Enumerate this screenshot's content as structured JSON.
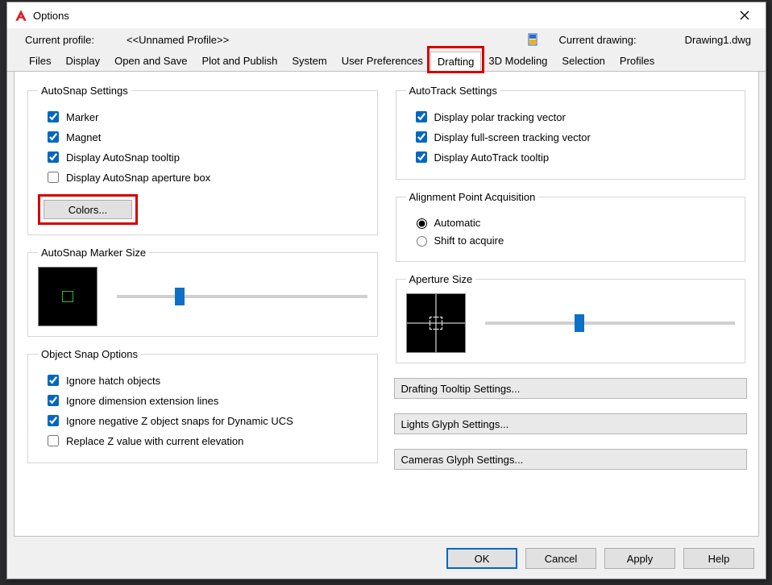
{
  "title": "Options",
  "profile": {
    "label": "Current profile:",
    "value": "<<Unnamed Profile>>",
    "drawing_label": "Current drawing:",
    "drawing_value": "Drawing1.dwg"
  },
  "tabs": {
    "files": "Files",
    "display": "Display",
    "open_save": "Open and Save",
    "plot_publish": "Plot and Publish",
    "system": "System",
    "user_prefs": "User Preferences",
    "drafting": "Drafting",
    "modeling": "3D Modeling",
    "selection": "Selection",
    "profiles": "Profiles"
  },
  "autosnap": {
    "legend": "AutoSnap Settings",
    "marker": "Marker",
    "magnet": "Magnet",
    "tooltip": "Display AutoSnap tooltip",
    "aperture": "Display AutoSnap aperture box",
    "colors_btn": "Colors..."
  },
  "marker_size": {
    "legend": "AutoSnap Marker Size"
  },
  "object_snap": {
    "legend": "Object Snap Options",
    "hatch": "Ignore hatch objects",
    "dim": "Ignore dimension extension lines",
    "negz": "Ignore negative Z object snaps for Dynamic UCS",
    "replz": "Replace Z value with current elevation"
  },
  "autotrack": {
    "legend": "AutoTrack Settings",
    "polar": "Display polar tracking vector",
    "fullscreen": "Display full-screen tracking vector",
    "tooltip": "Display AutoTrack tooltip"
  },
  "alignment": {
    "legend": "Alignment Point Acquisition",
    "auto": "Automatic",
    "shift": "Shift to acquire"
  },
  "aperture_size": {
    "legend": "Aperture Size"
  },
  "right_buttons": {
    "tooltip": "Drafting Tooltip Settings...",
    "lights": "Lights Glyph Settings...",
    "cameras": "Cameras Glyph Settings..."
  },
  "footer": {
    "ok": "OK",
    "cancel": "Cancel",
    "apply": "Apply",
    "help": "Help"
  }
}
